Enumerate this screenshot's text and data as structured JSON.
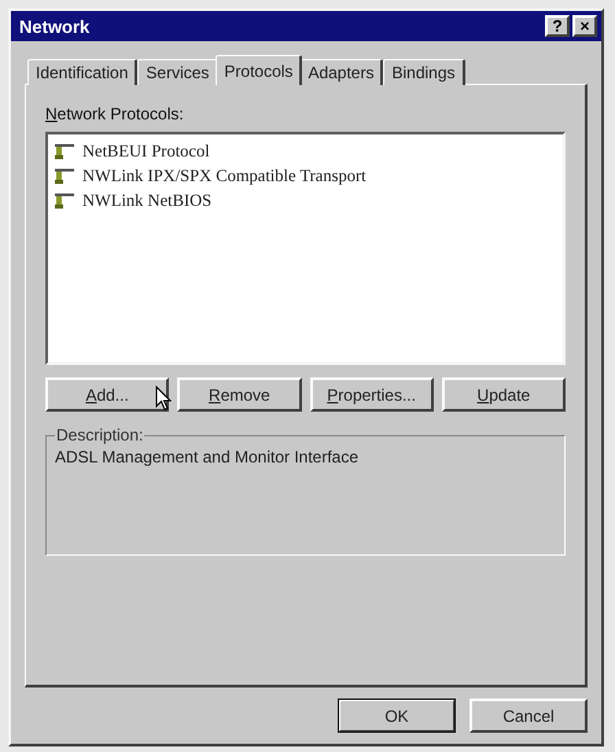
{
  "window": {
    "title": "Network",
    "help_button": "?",
    "close_button": "×"
  },
  "tabs": [
    {
      "label": "Identification",
      "selected": false
    },
    {
      "label": "Services",
      "selected": false
    },
    {
      "label": "Protocols",
      "selected": true
    },
    {
      "label": "Adapters",
      "selected": false
    },
    {
      "label": "Bindings",
      "selected": false
    }
  ],
  "protocols_label": "Network Protocols:",
  "protocols": [
    {
      "name": "NetBEUI Protocol",
      "selected": false
    },
    {
      "name": "NWLink IPX/SPX Compatible Transport",
      "selected": false
    },
    {
      "name": "NWLink NetBIOS",
      "selected": false
    }
  ],
  "list_buttons": [
    "Add...",
    "Remove",
    "Properties...",
    "Update"
  ],
  "description": {
    "label": "Description:",
    "text": "ADSL Management and Monitor Interface"
  },
  "buttons": [
    {
      "label": "OK",
      "default": true
    },
    {
      "label": "Cancel",
      "default": false
    }
  ]
}
